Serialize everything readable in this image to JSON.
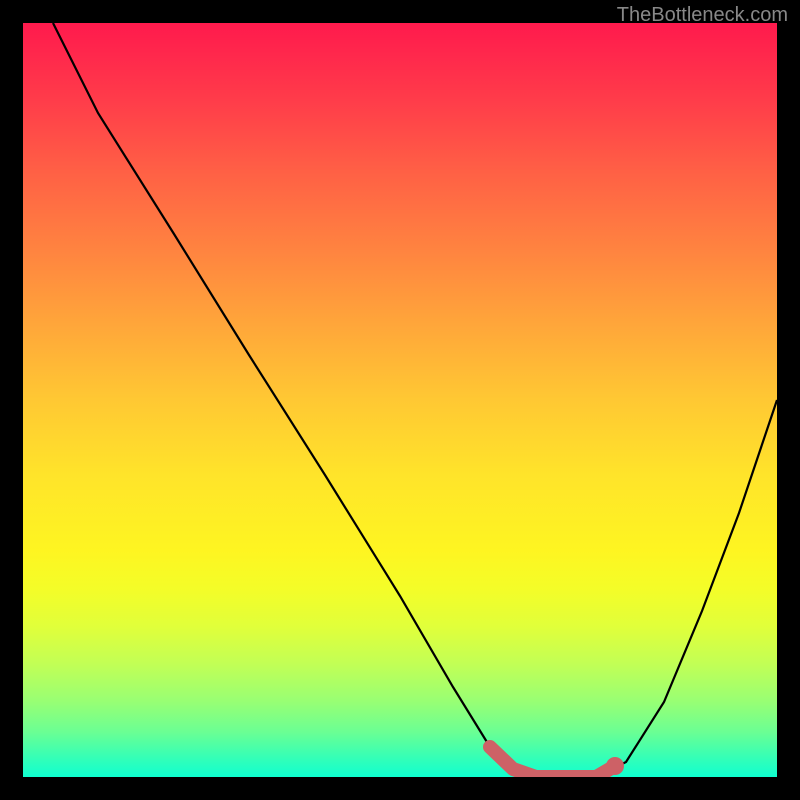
{
  "watermark": "TheBottleneck.com",
  "chart_data": {
    "type": "line",
    "title": "",
    "xlabel": "",
    "ylabel": "",
    "xlim": [
      0,
      100
    ],
    "ylim": [
      0,
      100
    ],
    "series": [
      {
        "name": "curve",
        "x": [
          4,
          10,
          20,
          30,
          40,
          50,
          57,
          62,
          65,
          68,
          72,
          76,
          80,
          85,
          90,
          95,
          100
        ],
        "y": [
          100,
          88,
          72,
          56,
          40,
          24,
          12,
          4,
          1,
          0,
          0,
          0,
          2,
          10,
          22,
          35,
          50
        ]
      },
      {
        "name": "optimal-range",
        "x": [
          62,
          65,
          68,
          72,
          76,
          78.5
        ],
        "y": [
          4,
          1,
          0,
          0,
          0,
          1.5
        ]
      }
    ],
    "marker": {
      "x": 78.5,
      "y": 1.5
    },
    "colors": {
      "curve": "#000000",
      "optimal": "#cd6166",
      "marker": "#cd6166",
      "gradient_top": "#ff1a4d",
      "gradient_bottom": "#0fffd0"
    }
  }
}
